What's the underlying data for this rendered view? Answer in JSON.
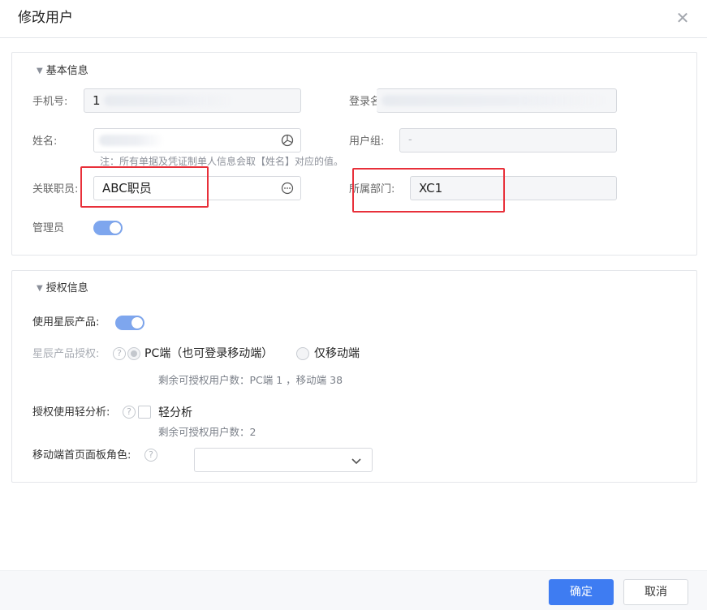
{
  "dialog": {
    "title": "修改用户",
    "close_icon": "close-icon"
  },
  "basic_info": {
    "section_title": "基本信息",
    "phone": {
      "label": "手机号:",
      "value": "1"
    },
    "login_name": {
      "label": "登录名"
    },
    "name": {
      "label": "姓名:",
      "note": "注：所有单据及凭证制单人信息会取【姓名】对应的值。"
    },
    "user_group": {
      "label": "用户组:",
      "value": "-"
    },
    "linked_staff": {
      "label": "关联职员:",
      "value": "ABC职员"
    },
    "department": {
      "label": "所属部门:",
      "value": "XC1"
    },
    "admin": {
      "label": "管理员",
      "enabled": true
    }
  },
  "auth_info": {
    "section_title": "授权信息",
    "use_product": {
      "label": "使用星辰产品:",
      "enabled": true
    },
    "product_auth": {
      "label": "星辰产品授权:",
      "options": [
        {
          "label": "PC端（也可登录移动端）",
          "selected": true
        },
        {
          "label": "仅移动端",
          "selected": false
        }
      ],
      "remaining": "剩余可授权用户数：PC端 1 ，移动端 38"
    },
    "light_analysis": {
      "label": "授权使用轻分析:",
      "checkbox_label": "轻分析",
      "checked": false,
      "remaining": "剩余可授权用户数：2"
    },
    "mobile_role": {
      "label": "移动端首页面板角色:",
      "value": ""
    }
  },
  "footer": {
    "confirm_label": "确定",
    "cancel_label": "取消"
  },
  "colors": {
    "primary": "#3e7cf2",
    "toggle_on": "#7ea6ee",
    "highlight": "#e8303a"
  }
}
